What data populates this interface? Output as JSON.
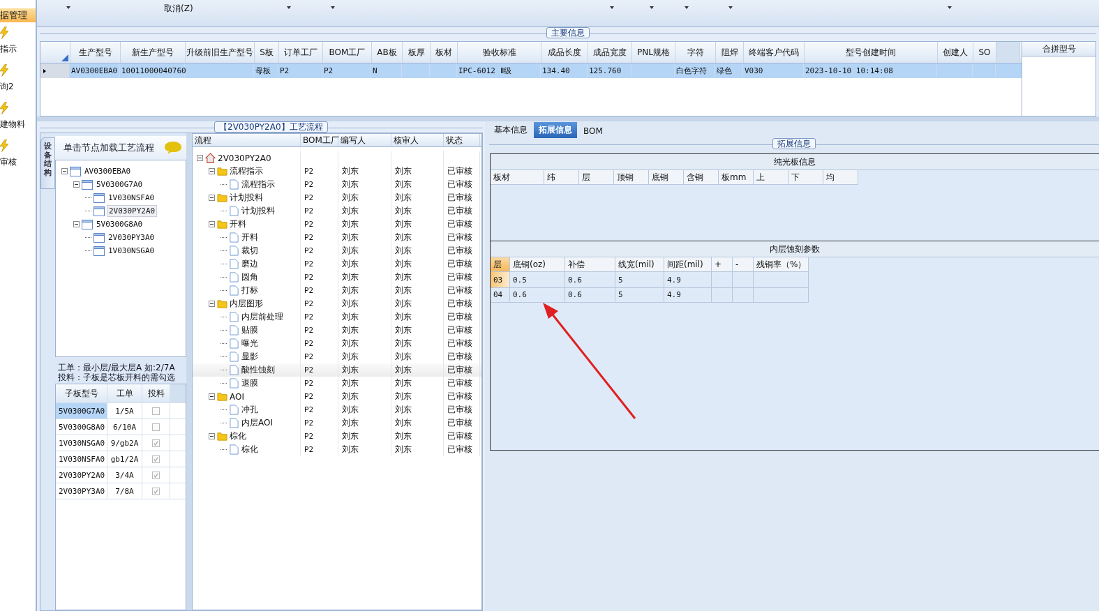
{
  "sidebar": {
    "items": [
      {
        "label": "据管理",
        "kind": "plain",
        "selected": true
      },
      {
        "label": "指示",
        "kind": "icon",
        "selected": false
      },
      {
        "label": "询2",
        "kind": "icon",
        "selected": false
      },
      {
        "label": "建物料",
        "kind": "icon",
        "selected": false
      },
      {
        "label": "审核",
        "kind": "icon",
        "selected": false
      }
    ]
  },
  "toolbar": {
    "cancel_label": "取消(Z)"
  },
  "main_info": {
    "title": "主要信息",
    "table": {
      "columns": [
        "生产型号",
        "新生产型号",
        "升级前旧生产型号",
        "S板",
        "订单工厂",
        "BOM工厂",
        "AB板",
        "板厚",
        "板材",
        "验收标准",
        "成品长度",
        "成品宽度",
        "PNL规格",
        "字符",
        "阻焊",
        "终端客户代码",
        "型号创建时间",
        "创建人",
        "SO"
      ],
      "rows": [
        {
          "selected": true,
          "cells": [
            "AV0300EBA0",
            "10011000040760",
            null,
            "母板",
            "P2",
            "P2",
            "N",
            null,
            null,
            "IPC-6012 Ⅱ级",
            "134.40",
            "125.760",
            null,
            "白色字符",
            "绿色",
            "V030",
            "2023-10-10 10:14:08",
            null,
            null
          ]
        }
      ]
    },
    "merge_panel": {
      "title": "合拼型号"
    }
  },
  "process_panel": {
    "title": "【2V030PY2A0】工艺流程",
    "side_tab": "设备结构",
    "tree_header": "单击节点加载工艺流程",
    "tree": [
      {
        "label": "AV0300EBA0",
        "selected": false,
        "expanded": true,
        "children": [
          {
            "label": "5V0300G7A0",
            "selected": false,
            "expanded": true,
            "children": [
              {
                "label": "1V030NSFA0",
                "selected": false
              },
              {
                "label": "2V030PY2A0",
                "selected": true
              }
            ]
          },
          {
            "label": "5V0300G8A0",
            "selected": false,
            "expanded": true,
            "children": [
              {
                "label": "2V030PY3A0",
                "selected": false
              },
              {
                "label": "1V030NSGA0",
                "selected": false
              }
            ]
          }
        ]
      }
    ],
    "notes": [
      "工单：最小层/最大层A 如:2/7A",
      "投料：子板是芯板开料的需勾选"
    ],
    "sub_boards": {
      "columns": [
        "子板型号",
        "工单",
        "投料"
      ],
      "rows": [
        {
          "model": "5V0300G7A0",
          "order": "1/5A",
          "checked": false,
          "selected": true
        },
        {
          "model": "5V0300G8A0",
          "order": "6/10A",
          "checked": false,
          "selected": false
        },
        {
          "model": "1V030NSGA0",
          "order": "9/gb2A",
          "checked": true,
          "selected": false
        },
        {
          "model": "1V030NSFA0",
          "order": "gb1/2A",
          "checked": true,
          "selected": false
        },
        {
          "model": "2V030PY2A0",
          "order": "3/4A",
          "checked": true,
          "selected": false
        },
        {
          "model": "2V030PY3A0",
          "order": "7/8A",
          "checked": true,
          "selected": false
        }
      ]
    },
    "flow": {
      "columns": [
        "流程",
        "BOM工厂",
        "编写人",
        "核审人",
        "状态"
      ],
      "tree": [
        {
          "label": "2V030PY2A0",
          "kind": "home",
          "selected": false,
          "expanded": true,
          "children": [
            {
              "label": "流程指示",
              "kind": "folder",
              "bom": "P2",
              "writer": "刘东",
              "reviewer": "刘东",
              "status": "已审核",
              "selected": false,
              "expanded": true,
              "children": [
                {
                  "label": "流程指示",
                  "kind": "doc",
                  "bom": "P2",
                  "writer": "刘东",
                  "reviewer": "刘东",
                  "status": "已审核",
                  "selected": false
                }
              ]
            },
            {
              "label": "计划投料",
              "kind": "folder",
              "bom": "P2",
              "writer": "刘东",
              "reviewer": "刘东",
              "status": "已审核",
              "selected": false,
              "expanded": true,
              "children": [
                {
                  "label": "计划投料",
                  "kind": "doc",
                  "bom": "P2",
                  "writer": "刘东",
                  "reviewer": "刘东",
                  "status": "已审核",
                  "selected": false
                }
              ]
            },
            {
              "label": "开料",
              "kind": "folder",
              "bom": "P2",
              "writer": "刘东",
              "reviewer": "刘东",
              "status": "已审核",
              "selected": false,
              "expanded": true,
              "children": [
                {
                  "label": "开料",
                  "kind": "doc",
                  "bom": "P2",
                  "writer": "刘东",
                  "reviewer": "刘东",
                  "status": "已审核",
                  "selected": false
                },
                {
                  "label": "裁切",
                  "kind": "doc",
                  "bom": "P2",
                  "writer": "刘东",
                  "reviewer": "刘东",
                  "status": "已审核",
                  "selected": false
                },
                {
                  "label": "磨边",
                  "kind": "doc",
                  "bom": "P2",
                  "writer": "刘东",
                  "reviewer": "刘东",
                  "status": "已审核",
                  "selected": false
                },
                {
                  "label": "圆角",
                  "kind": "doc",
                  "bom": "P2",
                  "writer": "刘东",
                  "reviewer": "刘东",
                  "status": "已审核",
                  "selected": false
                },
                {
                  "label": "打标",
                  "kind": "doc",
                  "bom": "P2",
                  "writer": "刘东",
                  "reviewer": "刘东",
                  "status": "已审核",
                  "selected": false
                }
              ]
            },
            {
              "label": "内层图形",
              "kind": "folder",
              "bom": "P2",
              "writer": "刘东",
              "reviewer": "刘东",
              "status": "已审核",
              "selected": false,
              "expanded": true,
              "children": [
                {
                  "label": "内层前处理",
                  "kind": "doc",
                  "bom": "P2",
                  "writer": "刘东",
                  "reviewer": "刘东",
                  "status": "已审核",
                  "selected": false
                },
                {
                  "label": "贴膜",
                  "kind": "doc",
                  "bom": "P2",
                  "writer": "刘东",
                  "reviewer": "刘东",
                  "status": "已审核",
                  "selected": false
                },
                {
                  "label": "曝光",
                  "kind": "doc",
                  "bom": "P2",
                  "writer": "刘东",
                  "reviewer": "刘东",
                  "status": "已审核",
                  "selected": false
                },
                {
                  "label": "显影",
                  "kind": "doc",
                  "bom": "P2",
                  "writer": "刘东",
                  "reviewer": "刘东",
                  "status": "已审核",
                  "selected": false
                },
                {
                  "label": "酸性蚀刻",
                  "kind": "doc",
                  "bom": "P2",
                  "writer": "刘东",
                  "reviewer": "刘东",
                  "status": "已审核",
                  "selected": true
                },
                {
                  "label": "退膜",
                  "kind": "doc",
                  "bom": "P2",
                  "writer": "刘东",
                  "reviewer": "刘东",
                  "status": "已审核",
                  "selected": false
                }
              ]
            },
            {
              "label": "AOI",
              "kind": "folder",
              "bom": "P2",
              "writer": "刘东",
              "reviewer": "刘东",
              "status": "已审核",
              "selected": false,
              "expanded": true,
              "children": [
                {
                  "label": "冲孔",
                  "kind": "doc",
                  "bom": "P2",
                  "writer": "刘东",
                  "reviewer": "刘东",
                  "status": "已审核",
                  "selected": false
                },
                {
                  "label": "内层AOI",
                  "kind": "doc",
                  "bom": "P2",
                  "writer": "刘东",
                  "reviewer": "刘东",
                  "status": "已审核",
                  "selected": false
                }
              ]
            },
            {
              "label": "棕化",
              "kind": "folder",
              "bom": "P2",
              "writer": "刘东",
              "reviewer": "刘东",
              "status": "已审核",
              "selected": false,
              "expanded": true,
              "children": [
                {
                  "label": "棕化",
                  "kind": "doc",
                  "bom": "P2",
                  "writer": "刘东",
                  "reviewer": "刘东",
                  "status": "已审核",
                  "selected": false
                }
              ]
            }
          ]
        }
      ]
    }
  },
  "detail_panel": {
    "tabs": [
      {
        "label": "基本信息",
        "selected": false
      },
      {
        "label": "拓展信息",
        "selected": true
      },
      {
        "label": "BOM",
        "selected": false
      }
    ],
    "group_title": "拓展信息",
    "bare_board": {
      "title": "纯光板信息",
      "columns": [
        "板材",
        "纬",
        "层",
        "顶铜",
        "底铜",
        "含铜",
        "板mm",
        "上",
        "下",
        "均"
      ]
    },
    "etching": {
      "title": "内层蚀刻参数",
      "columns": [
        "层",
        "底铜(oz)",
        "补偿",
        "线宽(mil)",
        "间距(mil)",
        "+",
        "-",
        "残铜率（%）"
      ],
      "rows": [
        {
          "selected": true,
          "cells": [
            "03",
            "0.5",
            "0.6",
            "5",
            "4.9",
            null,
            null,
            null
          ]
        },
        {
          "selected": false,
          "cells": [
            "04",
            "0.6",
            "0.6",
            "5",
            "4.9",
            null,
            null,
            null
          ]
        }
      ]
    }
  }
}
